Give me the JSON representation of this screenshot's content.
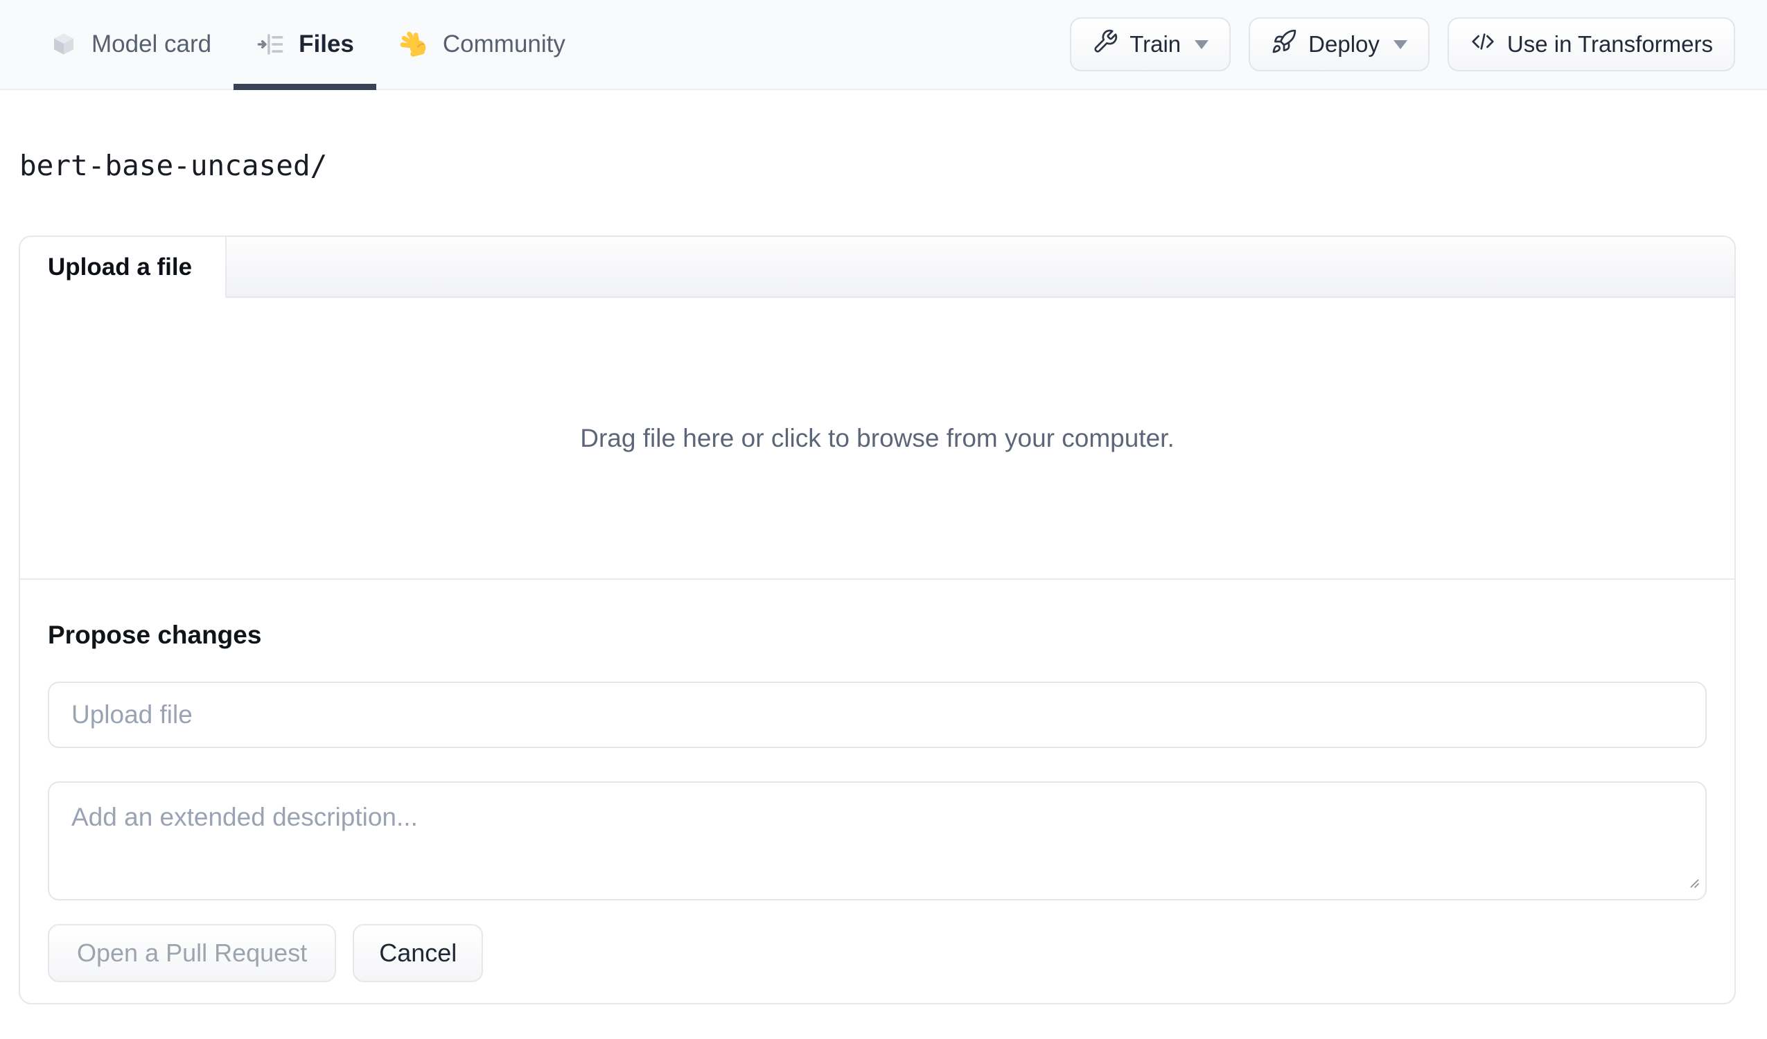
{
  "nav": {
    "tabs": [
      {
        "label": "Model card",
        "icon": "cube-icon",
        "active": false
      },
      {
        "label": "Files",
        "icon": "list-tree-icon",
        "active": true
      },
      {
        "label": "Community",
        "icon": "waving-hand-icon",
        "active": false
      }
    ],
    "actions": {
      "train": "Train",
      "deploy": "Deploy",
      "use_in_transformers": "Use in Transformers"
    }
  },
  "breadcrumb": "bert-base-uncased/",
  "upload": {
    "tab_label": "Upload a file",
    "dropzone_text": "Drag file here or click to browse from your computer."
  },
  "propose": {
    "heading": "Propose changes",
    "file_placeholder": "Upload file",
    "description_placeholder": "Add an extended description...",
    "open_pr_label": "Open a Pull Request",
    "cancel_label": "Cancel"
  },
  "colors": {
    "nav_background": "#f9fafb",
    "active_tab_underline": "#394357",
    "border": "#e5e7eb",
    "hand_emoji_yellow": "#ffc83d"
  }
}
